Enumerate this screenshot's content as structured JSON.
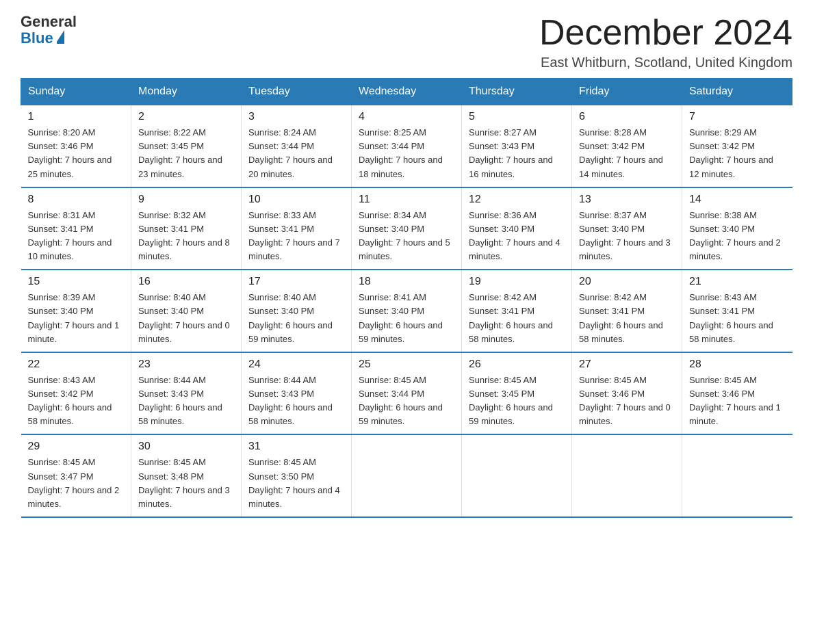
{
  "logo": {
    "general": "General",
    "blue": "Blue"
  },
  "title": {
    "month": "December 2024",
    "location": "East Whitburn, Scotland, United Kingdom"
  },
  "headers": [
    "Sunday",
    "Monday",
    "Tuesday",
    "Wednesday",
    "Thursday",
    "Friday",
    "Saturday"
  ],
  "weeks": [
    [
      {
        "day": "1",
        "sunrise": "8:20 AM",
        "sunset": "3:46 PM",
        "daylight": "7 hours and 25 minutes."
      },
      {
        "day": "2",
        "sunrise": "8:22 AM",
        "sunset": "3:45 PM",
        "daylight": "7 hours and 23 minutes."
      },
      {
        "day": "3",
        "sunrise": "8:24 AM",
        "sunset": "3:44 PM",
        "daylight": "7 hours and 20 minutes."
      },
      {
        "day": "4",
        "sunrise": "8:25 AM",
        "sunset": "3:44 PM",
        "daylight": "7 hours and 18 minutes."
      },
      {
        "day": "5",
        "sunrise": "8:27 AM",
        "sunset": "3:43 PM",
        "daylight": "7 hours and 16 minutes."
      },
      {
        "day": "6",
        "sunrise": "8:28 AM",
        "sunset": "3:42 PM",
        "daylight": "7 hours and 14 minutes."
      },
      {
        "day": "7",
        "sunrise": "8:29 AM",
        "sunset": "3:42 PM",
        "daylight": "7 hours and 12 minutes."
      }
    ],
    [
      {
        "day": "8",
        "sunrise": "8:31 AM",
        "sunset": "3:41 PM",
        "daylight": "7 hours and 10 minutes."
      },
      {
        "day": "9",
        "sunrise": "8:32 AM",
        "sunset": "3:41 PM",
        "daylight": "7 hours and 8 minutes."
      },
      {
        "day": "10",
        "sunrise": "8:33 AM",
        "sunset": "3:41 PM",
        "daylight": "7 hours and 7 minutes."
      },
      {
        "day": "11",
        "sunrise": "8:34 AM",
        "sunset": "3:40 PM",
        "daylight": "7 hours and 5 minutes."
      },
      {
        "day": "12",
        "sunrise": "8:36 AM",
        "sunset": "3:40 PM",
        "daylight": "7 hours and 4 minutes."
      },
      {
        "day": "13",
        "sunrise": "8:37 AM",
        "sunset": "3:40 PM",
        "daylight": "7 hours and 3 minutes."
      },
      {
        "day": "14",
        "sunrise": "8:38 AM",
        "sunset": "3:40 PM",
        "daylight": "7 hours and 2 minutes."
      }
    ],
    [
      {
        "day": "15",
        "sunrise": "8:39 AM",
        "sunset": "3:40 PM",
        "daylight": "7 hours and 1 minute."
      },
      {
        "day": "16",
        "sunrise": "8:40 AM",
        "sunset": "3:40 PM",
        "daylight": "7 hours and 0 minutes."
      },
      {
        "day": "17",
        "sunrise": "8:40 AM",
        "sunset": "3:40 PM",
        "daylight": "6 hours and 59 minutes."
      },
      {
        "day": "18",
        "sunrise": "8:41 AM",
        "sunset": "3:40 PM",
        "daylight": "6 hours and 59 minutes."
      },
      {
        "day": "19",
        "sunrise": "8:42 AM",
        "sunset": "3:41 PM",
        "daylight": "6 hours and 58 minutes."
      },
      {
        "day": "20",
        "sunrise": "8:42 AM",
        "sunset": "3:41 PM",
        "daylight": "6 hours and 58 minutes."
      },
      {
        "day": "21",
        "sunrise": "8:43 AM",
        "sunset": "3:41 PM",
        "daylight": "6 hours and 58 minutes."
      }
    ],
    [
      {
        "day": "22",
        "sunrise": "8:43 AM",
        "sunset": "3:42 PM",
        "daylight": "6 hours and 58 minutes."
      },
      {
        "day": "23",
        "sunrise": "8:44 AM",
        "sunset": "3:43 PM",
        "daylight": "6 hours and 58 minutes."
      },
      {
        "day": "24",
        "sunrise": "8:44 AM",
        "sunset": "3:43 PM",
        "daylight": "6 hours and 58 minutes."
      },
      {
        "day": "25",
        "sunrise": "8:45 AM",
        "sunset": "3:44 PM",
        "daylight": "6 hours and 59 minutes."
      },
      {
        "day": "26",
        "sunrise": "8:45 AM",
        "sunset": "3:45 PM",
        "daylight": "6 hours and 59 minutes."
      },
      {
        "day": "27",
        "sunrise": "8:45 AM",
        "sunset": "3:46 PM",
        "daylight": "7 hours and 0 minutes."
      },
      {
        "day": "28",
        "sunrise": "8:45 AM",
        "sunset": "3:46 PM",
        "daylight": "7 hours and 1 minute."
      }
    ],
    [
      {
        "day": "29",
        "sunrise": "8:45 AM",
        "sunset": "3:47 PM",
        "daylight": "7 hours and 2 minutes."
      },
      {
        "day": "30",
        "sunrise": "8:45 AM",
        "sunset": "3:48 PM",
        "daylight": "7 hours and 3 minutes."
      },
      {
        "day": "31",
        "sunrise": "8:45 AM",
        "sunset": "3:50 PM",
        "daylight": "7 hours and 4 minutes."
      },
      null,
      null,
      null,
      null
    ]
  ]
}
